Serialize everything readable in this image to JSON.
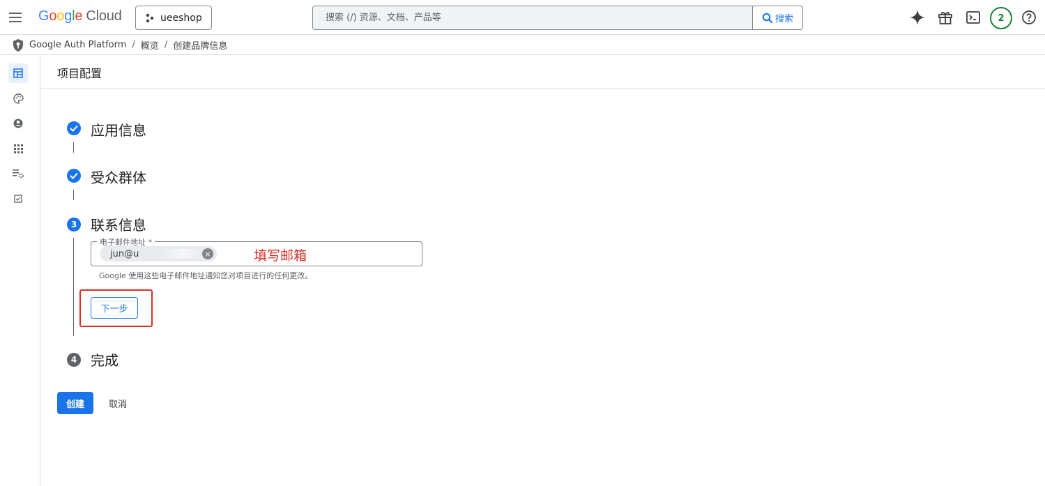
{
  "header": {
    "logo_google": [
      "G",
      "o",
      "o",
      "g",
      "l",
      "e"
    ],
    "logo_cloud": "Cloud",
    "project_name": "ueeshop",
    "search_placeholder": "搜索 (/) 资源、文档、产品等",
    "search_button": "搜索",
    "notification_count": "2"
  },
  "breadcrumb": {
    "items": [
      "Google Auth Platform",
      "概览",
      "创建品牌信息"
    ],
    "separator": "/"
  },
  "page": {
    "title": "项目配置"
  },
  "stepper": {
    "steps": [
      {
        "number": "",
        "label": "应用信息",
        "state": "done"
      },
      {
        "number": "",
        "label": "受众群体",
        "state": "done"
      },
      {
        "number": "3",
        "label": "联系信息",
        "state": "current"
      },
      {
        "number": "4",
        "label": "完成",
        "state": "todo"
      }
    ]
  },
  "contact_step": {
    "email_label": "电子邮件地址 *",
    "email_chip_value": "jun@u",
    "annotation": "填写邮箱",
    "helper_text": "Google 使用这些电子邮件地址通知您对项目进行的任何更改。",
    "next_button": "下一步"
  },
  "actions": {
    "create_button": "创建",
    "cancel_button": "取消"
  },
  "colors": {
    "primary": "#1a73e8",
    "annotation_red": "#d93025",
    "notification_green": "#188038"
  }
}
